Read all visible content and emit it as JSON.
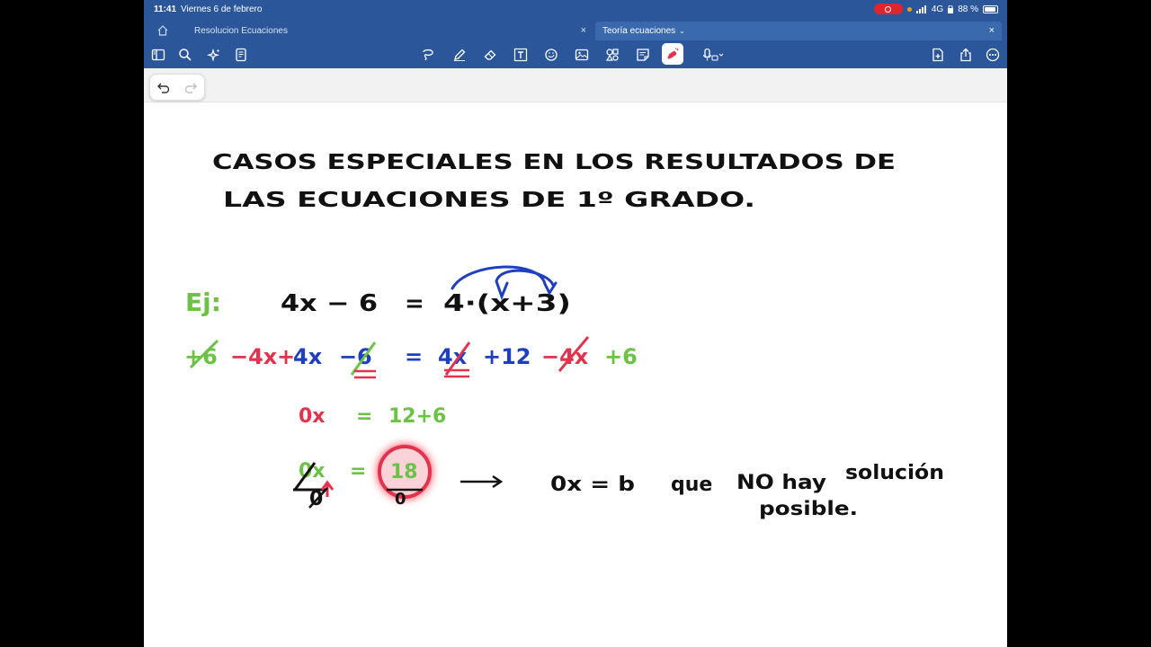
{
  "status_bar": {
    "time": "11:41",
    "date": "Viernes 6 de febrero",
    "network": "4G",
    "battery": "88 %"
  },
  "tabs": [
    {
      "label": "Resolucion Ecuaciones",
      "active": false
    },
    {
      "label": "Teoría ecuaciones",
      "active": true
    }
  ],
  "toolbar_icons": [
    "sidebar-icon",
    "search-icon",
    "sparkle-icon",
    "document-icon",
    "lasso-icon",
    "pen-icon",
    "eraser-icon",
    "textbox-icon",
    "shapes-icon",
    "image-icon",
    "elements-icon",
    "sticky-note-icon",
    "laser-pointer-icon",
    "microphone-icon",
    "add-page-icon",
    "share-icon",
    "more-icon"
  ],
  "colors": {
    "app_bar": "#2b579a",
    "ink_black": "#111111",
    "ink_green": "#6cc247",
    "ink_red": "#e2334e",
    "ink_blue": "#1f3fbf"
  },
  "note": {
    "title_line1": "CASOS ESPECIALES EN LOS RESULTADOS DE",
    "title_line2": "LAS ECUACIONES DE 1º GRADO.",
    "example_label": "Ej:",
    "eq1_left": "4x − 6",
    "eq1_eq": "=",
    "eq1_right": "4·(x+3)",
    "row2": {
      "g1": "+6",
      "r1": "−4x",
      "plus": "+",
      "b1": "4x",
      "minus": "−",
      "b2": "6",
      "eq": "=",
      "b3": "4x",
      "b4": "+12",
      "r2": "−4x",
      "g2": "+6"
    },
    "eq3_left": "0x",
    "eq3_eq": "=",
    "eq3_right": "12+6",
    "eq4_left": "0x",
    "eq4_eq": "=",
    "eq4_right": "18",
    "eq4_zero": "0",
    "eq4_circ": "0",
    "conclusion_eq": "0x = b",
    "conclusion_text_1": "que",
    "conclusion_text_2": "NO hay",
    "conclusion_text_3": "solución",
    "conclusion_text_4": "posible."
  }
}
